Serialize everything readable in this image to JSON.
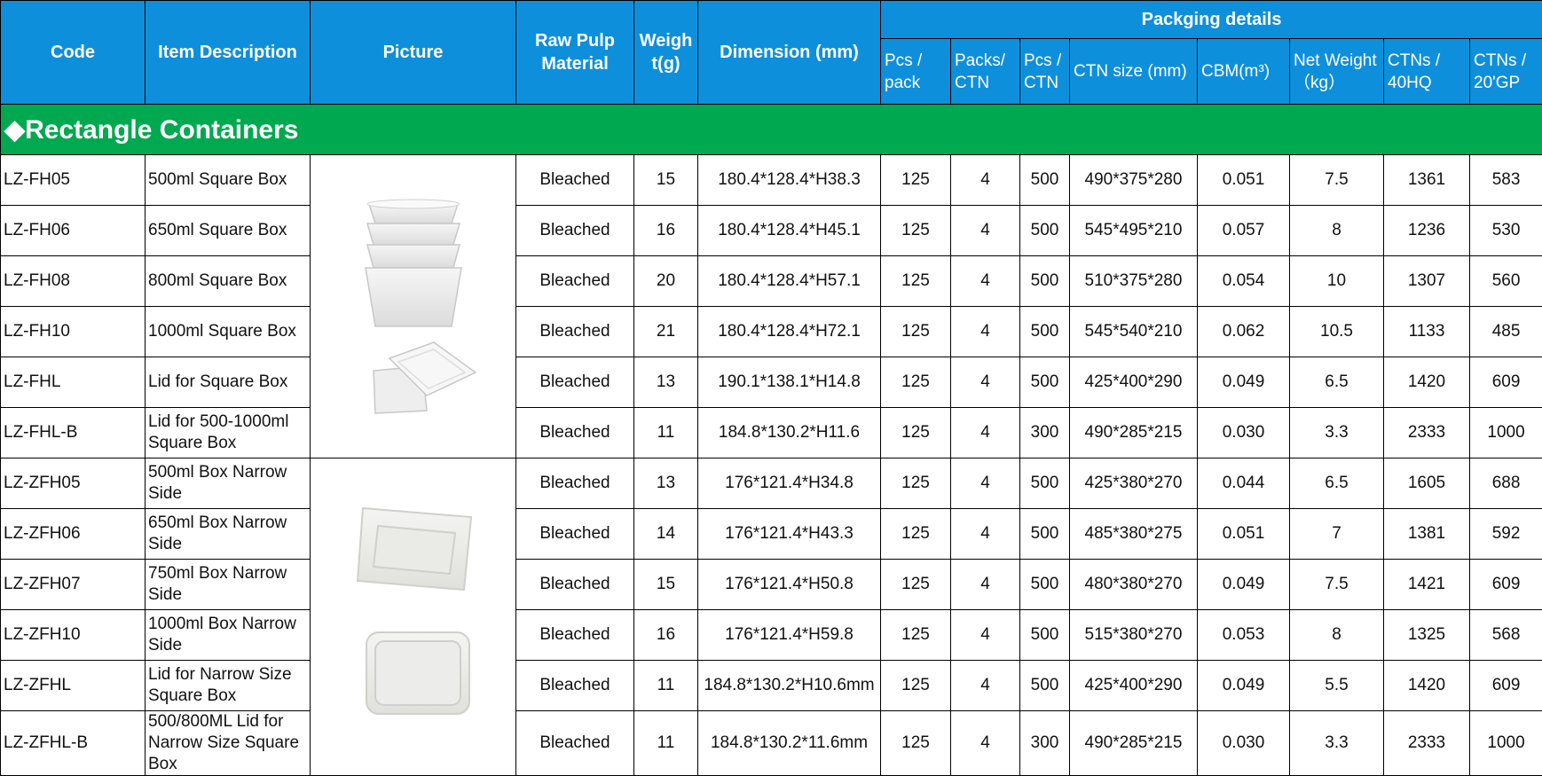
{
  "header": {
    "code": "Code",
    "item_description": "Item Description",
    "picture": "Picture",
    "raw_pulp_material": "Raw  Pulp Material",
    "weight": "Weigh t(g)",
    "dimension": "Dimension (mm)",
    "packaging_details": "Packging details",
    "pcs_pack": "Pcs / pack",
    "packs_ctn": "Packs/ CTN",
    "pcs_ctn": "Pcs / CTN",
    "ctn_size": "CTN size (mm)",
    "cbm": "CBM(m³)",
    "net_weight": "Net Weight （kg）",
    "ctns_40hq": "CTNs / 40HQ",
    "ctns_20gp": "CTNs / 20'GP"
  },
  "section": {
    "title": "◆Rectangle Containers"
  },
  "rows": [
    {
      "code": "LZ-FH05",
      "desc": "500ml Square Box",
      "material": "Bleached",
      "weight": "15",
      "dimension": "180.4*128.4*H38.3",
      "pcs_pack": "125",
      "packs_ctn": "4",
      "pcs_ctn": "500",
      "ctn_size": "490*375*280",
      "cbm": "0.051",
      "net_weight": "7.5",
      "ctns_40hq": "1361",
      "ctns_20gp": "583"
    },
    {
      "code": "LZ-FH06",
      "desc": "650ml Square Box",
      "material": "Bleached",
      "weight": "16",
      "dimension": "180.4*128.4*H45.1",
      "pcs_pack": "125",
      "packs_ctn": "4",
      "pcs_ctn": "500",
      "ctn_size": "545*495*210",
      "cbm": "0.057",
      "net_weight": "8",
      "ctns_40hq": "1236",
      "ctns_20gp": "530"
    },
    {
      "code": "LZ-FH08",
      "desc": "800ml Square Box",
      "material": "Bleached",
      "weight": "20",
      "dimension": "180.4*128.4*H57.1",
      "pcs_pack": "125",
      "packs_ctn": "4",
      "pcs_ctn": "500",
      "ctn_size": "510*375*280",
      "cbm": "0.054",
      "net_weight": "10",
      "ctns_40hq": "1307",
      "ctns_20gp": "560"
    },
    {
      "code": "LZ-FH10",
      "desc": "1000ml Square Box",
      "material": "Bleached",
      "weight": "21",
      "dimension": "180.4*128.4*H72.1",
      "pcs_pack": "125",
      "packs_ctn": "4",
      "pcs_ctn": "500",
      "ctn_size": "545*540*210",
      "cbm": "0.062",
      "net_weight": "10.5",
      "ctns_40hq": "1133",
      "ctns_20gp": "485"
    },
    {
      "code": "LZ-FHL",
      "desc": "Lid for Square Box",
      "material": "Bleached",
      "weight": "13",
      "dimension": "190.1*138.1*H14.8",
      "pcs_pack": "125",
      "packs_ctn": "4",
      "pcs_ctn": "500",
      "ctn_size": "425*400*290",
      "cbm": "0.049",
      "net_weight": "6.5",
      "ctns_40hq": "1420",
      "ctns_20gp": "609"
    },
    {
      "code": "LZ-FHL-B",
      "desc": "Lid for 500-1000ml Square Box",
      "material": "Bleached",
      "weight": "11",
      "dimension": "184.8*130.2*H11.6",
      "pcs_pack": "125",
      "packs_ctn": "4",
      "pcs_ctn": "300",
      "ctn_size": "490*285*215",
      "cbm": "0.030",
      "net_weight": "3.3",
      "ctns_40hq": "2333",
      "ctns_20gp": "1000"
    },
    {
      "code": "LZ-ZFH05",
      "desc": "500ml Box Narrow Side",
      "material": "Bleached",
      "weight": "13",
      "dimension": "176*121.4*H34.8",
      "pcs_pack": "125",
      "packs_ctn": "4",
      "pcs_ctn": "500",
      "ctn_size": "425*380*270",
      "cbm": "0.044",
      "net_weight": "6.5",
      "ctns_40hq": "1605",
      "ctns_20gp": "688"
    },
    {
      "code": "LZ-ZFH06",
      "desc": "650ml Box Narrow Side",
      "material": "Bleached",
      "weight": "14",
      "dimension": "176*121.4*H43.3",
      "pcs_pack": "125",
      "packs_ctn": "4",
      "pcs_ctn": "500",
      "ctn_size": "485*380*275",
      "cbm": "0.051",
      "net_weight": "7",
      "ctns_40hq": "1381",
      "ctns_20gp": "592"
    },
    {
      "code": "LZ-ZFH07",
      "desc": "750ml Box Narrow Side",
      "material": "Bleached",
      "weight": "15",
      "dimension": "176*121.4*H50.8",
      "pcs_pack": "125",
      "packs_ctn": "4",
      "pcs_ctn": "500",
      "ctn_size": "480*380*270",
      "cbm": "0.049",
      "net_weight": "7.5",
      "ctns_40hq": "1421",
      "ctns_20gp": "609"
    },
    {
      "code": "LZ-ZFH10",
      "desc": "1000ml Box Narrow Side",
      "material": "Bleached",
      "weight": "16",
      "dimension": "176*121.4*H59.8",
      "pcs_pack": "125",
      "packs_ctn": "4",
      "pcs_ctn": "500",
      "ctn_size": "515*380*270",
      "cbm": "0.053",
      "net_weight": "8",
      "ctns_40hq": "1325",
      "ctns_20gp": "568"
    },
    {
      "code": "LZ-ZFHL",
      "desc": "Lid for Narrow Size Square Box",
      "material": "Bleached",
      "weight": "11",
      "dimension": "184.8*130.2*H10.6mm",
      "pcs_pack": "125",
      "packs_ctn": "4",
      "pcs_ctn": "500",
      "ctn_size": "425*400*290",
      "cbm": "0.049",
      "net_weight": "5.5",
      "ctns_40hq": "1420",
      "ctns_20gp": "609"
    },
    {
      "code": "LZ-ZFHL-B",
      "desc": "500/800ML Lid for Narrow Size Square Box",
      "material": "Bleached",
      "weight": "11",
      "dimension": "184.8*130.2*11.6mm",
      "pcs_pack": "125",
      "packs_ctn": "4",
      "pcs_ctn": "300",
      "ctn_size": "490*285*215",
      "cbm": "0.030",
      "net_weight": "3.3",
      "ctns_40hq": "2333",
      "ctns_20gp": "1000"
    }
  ]
}
